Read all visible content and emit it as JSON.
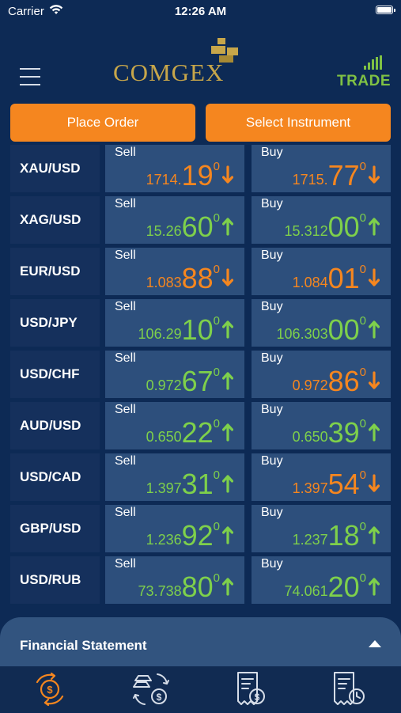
{
  "status": {
    "carrier": "Carrier",
    "time": "12:26 AM"
  },
  "header": {
    "logo_text": "COMGEX",
    "trade_label": "TRADE"
  },
  "actions": {
    "place_order": "Place Order",
    "select_instrument": "Select Instrument"
  },
  "labels": {
    "sell": "Sell",
    "buy": "Buy"
  },
  "colors": {
    "up": "#7ed04b",
    "down": "#f5861f",
    "accent": "#f5861f",
    "gold": "#c7a64a"
  },
  "quotes": [
    {
      "symbol": "XAU/USD",
      "sell": {
        "pre": "1714.",
        "big": "19",
        "sup": "0",
        "dir": "down"
      },
      "buy": {
        "pre": "1715.",
        "big": "77",
        "sup": "0",
        "dir": "down"
      }
    },
    {
      "symbol": "XAG/USD",
      "sell": {
        "pre": "15.26",
        "big": "60",
        "sup": "0",
        "dir": "up"
      },
      "buy": {
        "pre": "15.312",
        "big": "00",
        "sup": "0",
        "dir": "up"
      }
    },
    {
      "symbol": "EUR/USD",
      "sell": {
        "pre": "1.083",
        "big": "88",
        "sup": "0",
        "dir": "down"
      },
      "buy": {
        "pre": "1.084",
        "big": "01",
        "sup": "0",
        "dir": "down"
      }
    },
    {
      "symbol": "USD/JPY",
      "sell": {
        "pre": "106.29",
        "big": "10",
        "sup": "0",
        "dir": "up"
      },
      "buy": {
        "pre": "106.303",
        "big": "00",
        "sup": "0",
        "dir": "up"
      }
    },
    {
      "symbol": "USD/CHF",
      "sell": {
        "pre": "0.972",
        "big": "67",
        "sup": "0",
        "dir": "up"
      },
      "buy": {
        "pre": "0.972",
        "big": "86",
        "sup": "0",
        "dir": "down"
      }
    },
    {
      "symbol": "AUD/USD",
      "sell": {
        "pre": "0.650",
        "big": "22",
        "sup": "0",
        "dir": "up"
      },
      "buy": {
        "pre": "0.650",
        "big": "39",
        "sup": "0",
        "dir": "up"
      }
    },
    {
      "symbol": "USD/CAD",
      "sell": {
        "pre": "1.397",
        "big": "31",
        "sup": "0",
        "dir": "up"
      },
      "buy": {
        "pre": "1.397",
        "big": "54",
        "sup": "0",
        "dir": "down"
      }
    },
    {
      "symbol": "GBP/USD",
      "sell": {
        "pre": "1.236",
        "big": "92",
        "sup": "0",
        "dir": "up"
      },
      "buy": {
        "pre": "1.237",
        "big": "18",
        "sup": "0",
        "dir": "up"
      }
    },
    {
      "symbol": "USD/RUB",
      "sell": {
        "pre": "73.738",
        "big": "80",
        "sup": "0",
        "dir": "up"
      },
      "buy": {
        "pre": "74.061",
        "big": "20",
        "sup": "0",
        "dir": "up"
      }
    }
  ],
  "panel": {
    "financial_statement": "Financial Statement"
  },
  "tabs": [
    {
      "icon": "exchange-dollar-icon",
      "active": true
    },
    {
      "icon": "gold-exchange-icon",
      "active": false
    },
    {
      "icon": "invoice-dollar-icon",
      "active": false
    },
    {
      "icon": "invoice-clock-icon",
      "active": false
    }
  ]
}
